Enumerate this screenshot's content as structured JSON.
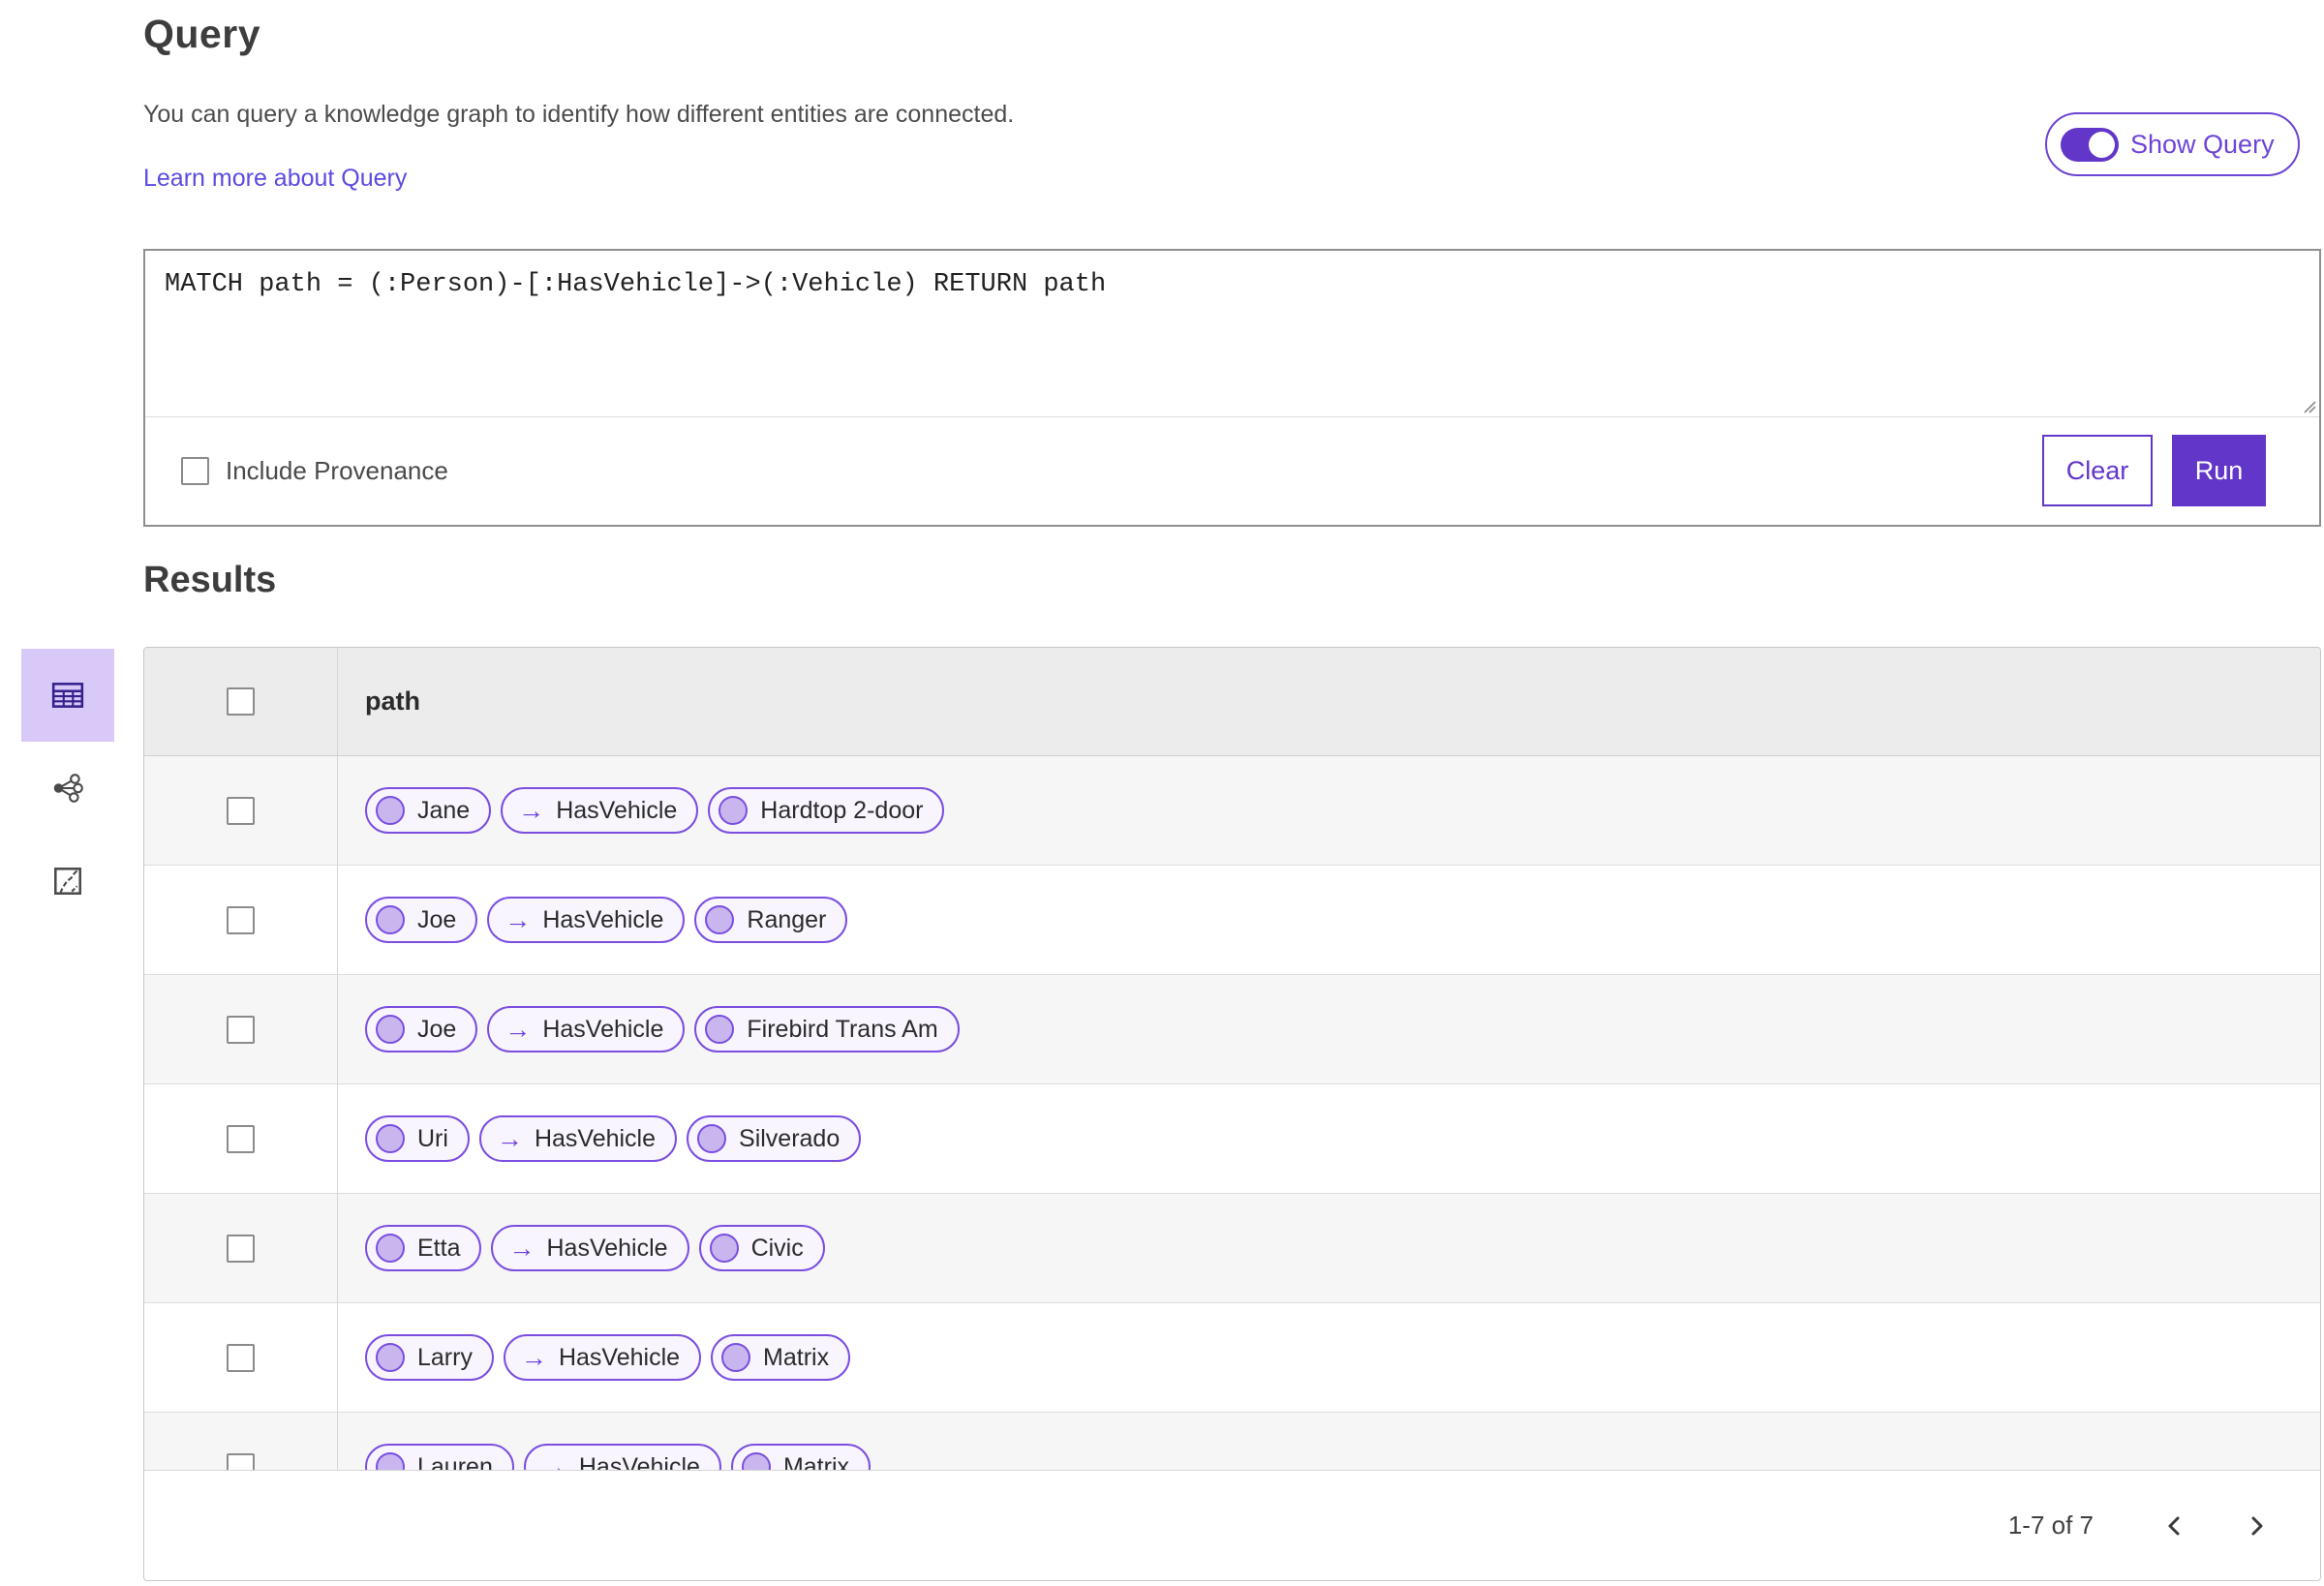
{
  "page": {
    "title": "Query",
    "description": "You can query a knowledge graph to identify how different entities are connected.",
    "learn_more_label": "Learn more about Query",
    "show_query_label": "Show Query",
    "show_query_on": true
  },
  "query_panel": {
    "query_text": "MATCH path = (:Person)-[:HasVehicle]->(:Vehicle) RETURN path",
    "include_provenance_label": "Include Provenance",
    "include_provenance_checked": false,
    "clear_label": "Clear",
    "run_label": "Run"
  },
  "results": {
    "title": "Results",
    "column_header": "path",
    "select_all_checked": false,
    "rows": [
      {
        "source": "Jane",
        "relation": "HasVehicle",
        "target": "Hardtop 2-door"
      },
      {
        "source": "Joe",
        "relation": "HasVehicle",
        "target": "Ranger"
      },
      {
        "source": "Joe",
        "relation": "HasVehicle",
        "target": "Firebird Trans Am"
      },
      {
        "source": "Uri",
        "relation": "HasVehicle",
        "target": "Silverado"
      },
      {
        "source": "Etta",
        "relation": "HasVehicle",
        "target": "Civic"
      },
      {
        "source": "Larry",
        "relation": "HasVehicle",
        "target": "Matrix"
      },
      {
        "source": "Lauren",
        "relation": "HasVehicle",
        "target": "Matrix"
      }
    ],
    "pagination": {
      "range_label": "1-7 of 7"
    }
  },
  "sidebar": {
    "views": [
      {
        "name": "table-view",
        "selected": true
      },
      {
        "name": "link-chart-view",
        "selected": false
      },
      {
        "name": "map-view",
        "selected": false
      }
    ]
  },
  "icons": {
    "edge_arrow": "→",
    "prev": "chevron-left",
    "next": "chevron-right"
  },
  "colors": {
    "accent": "#6236c9",
    "accent-border": "#6d44d6",
    "pill-border": "#7b4ee0",
    "pill-bg": "#f8f5fe",
    "node-fill": "#c9b6ef",
    "link": "#5b4be0",
    "selected-view-bg": "#d9c9f8",
    "icon-purple": "#35208c"
  }
}
